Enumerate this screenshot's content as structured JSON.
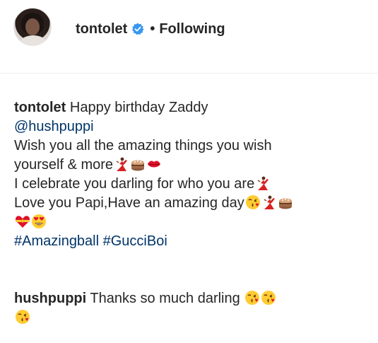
{
  "post": {
    "username": "tontolet",
    "separator": "•",
    "follow_status": "Following"
  },
  "caption": {
    "username": "tontolet",
    "line1": "Happy birthday Zaddy",
    "mention": "@hushpuppi",
    "line3": "Wish you all the amazing things you wish",
    "line4": "yourself & more",
    "line5": "I celebrate you darling for who you are",
    "line6": "Love you Papi,Have an amazing day",
    "hashtags": "#Amazingball #GucciBoi"
  },
  "reply": {
    "username": "hushpuppi",
    "text": "Thanks so much darling"
  },
  "icons": {
    "verified": "verified-badge-icon",
    "dancer": "dancer-emoji",
    "cake": "cake-emoji",
    "kiss_lips": "kiss-lips-emoji",
    "kissing_face": "face-blowing-kiss-emoji",
    "ribbon_heart": "heart-with-ribbon-emoji",
    "heart_eyes": "heart-eyes-emoji"
  },
  "colors": {
    "text": "#262626",
    "link": "#003569",
    "verified_blue": "#3897f0",
    "divider": "#efefef"
  }
}
